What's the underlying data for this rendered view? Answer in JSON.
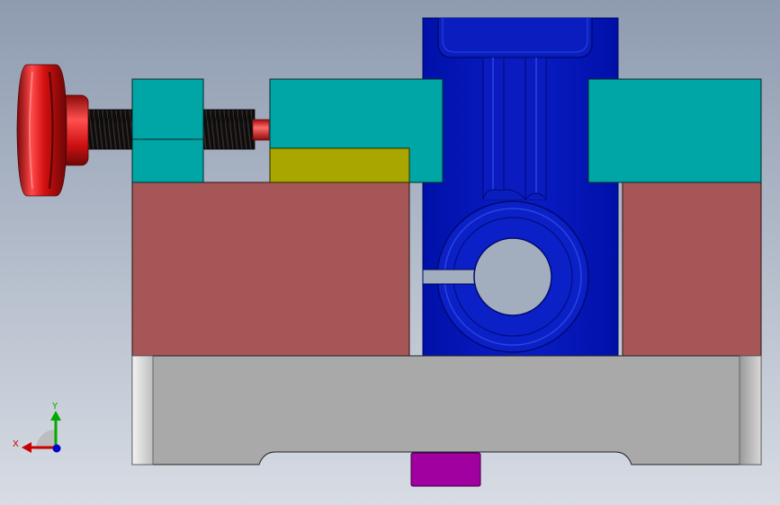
{
  "view": {
    "background_top": "#8e9bb0",
    "background_bottom": "#d7dce4"
  },
  "colors": {
    "knob_red": "#e01515",
    "knob_dark": "#8a0a0a",
    "thread_black": "#111111",
    "clamp_teal": "#00a5a5",
    "shim_olive": "#a9a600",
    "body_rose": "#a65656",
    "base_gray": "#a9a9a9",
    "base_end_light": "#e6e6e6",
    "foot_magenta": "#a000a0",
    "arm_blue": "#0014b8",
    "arm_blue_dark": "#000a78",
    "arm_blue_light": "#2a45e0",
    "hole_gray": "#a2adbd"
  },
  "triad": {
    "x_label": "X",
    "y_label": "Y",
    "x_color": "#cc0000",
    "y_color": "#00aa00",
    "z_color": "#0000cc"
  },
  "parts": [
    {
      "name": "adjust-knob",
      "color_key": "knob_red"
    },
    {
      "name": "threaded-screw",
      "color_key": "thread_black"
    },
    {
      "name": "left-clamp-block",
      "color_key": "clamp_teal"
    },
    {
      "name": "center-clamp-block",
      "color_key": "clamp_teal"
    },
    {
      "name": "right-clamp-block",
      "color_key": "clamp_teal"
    },
    {
      "name": "shim-plate",
      "color_key": "shim_olive"
    },
    {
      "name": "left-body",
      "color_key": "body_rose"
    },
    {
      "name": "right-body",
      "color_key": "body_rose"
    },
    {
      "name": "base-plate",
      "color_key": "base_gray"
    },
    {
      "name": "locating-foot",
      "color_key": "foot_magenta"
    },
    {
      "name": "split-clamp-arm",
      "color_key": "arm_blue"
    }
  ]
}
